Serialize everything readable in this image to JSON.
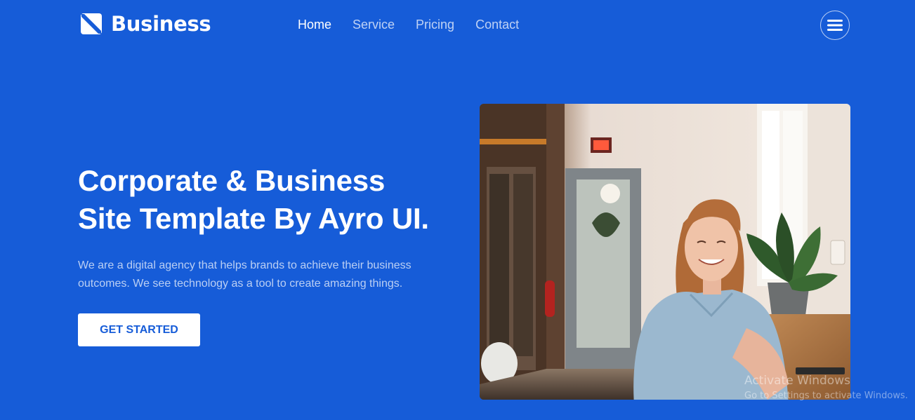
{
  "header": {
    "brand": "Business",
    "logo_icon": "brand-logo-icon",
    "nav": [
      {
        "label": "Home",
        "active": true
      },
      {
        "label": "Service",
        "active": false
      },
      {
        "label": "Pricing",
        "active": false
      },
      {
        "label": "Contact",
        "active": false
      }
    ],
    "menu_icon": "hamburger-menu-icon"
  },
  "hero": {
    "title_line1": "Corporate & Business",
    "title_line2": "Site Template By Ayro UI.",
    "description_line1": "We are a digital agency that helps brands to achieve their business",
    "description_line2": "outcomes. We see technology as a tool to create amazing things.",
    "cta_label": "GET STARTED",
    "image_alt": "Smiling woman sitting by a window in a cafe"
  },
  "watermark": {
    "title": "Activate Windows",
    "subtitle": "Go to Settings to activate Windows."
  },
  "colors": {
    "background": "#165cd8",
    "text": "#ffffff",
    "button_bg": "#ffffff",
    "button_text": "#165cd8"
  }
}
